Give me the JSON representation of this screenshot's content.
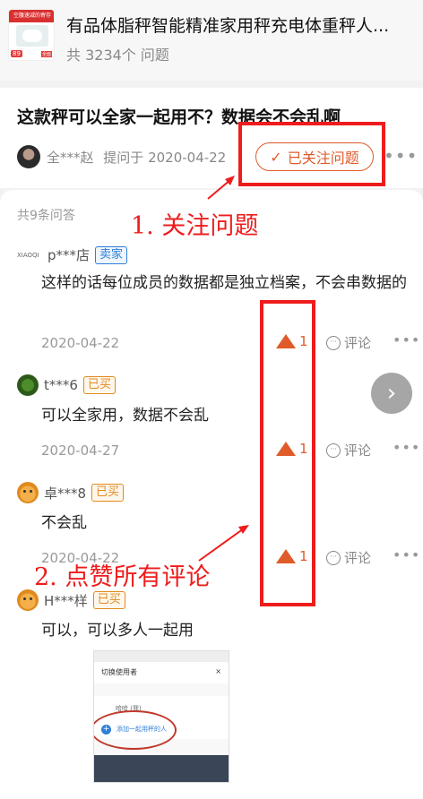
{
  "product": {
    "title": "有品体脂秤智能精准家用秤充电体重秤人...",
    "question_count": "共 3234个 问题",
    "thumb": {
      "banner": "空腹速减的寄存",
      "price": "89",
      "tag": "全面"
    }
  },
  "question": {
    "title": "这款秤可以全家一起用不？数据会不会乱啊",
    "asker_name": "全***赵",
    "asked_on": "提问于 2020-04-22",
    "follow_label": "已关注问题",
    "follow_icon": "✓"
  },
  "answers_header": "共9条问答",
  "answers": [
    {
      "user": "p***店",
      "avatar_text": "XIAOQI",
      "badge": "卖家",
      "text": "这样的话每位成员的数据都是独立档案，不会串数据的",
      "date": "2020-04-22",
      "likes": "1",
      "comment_label": "评论"
    },
    {
      "user": "t***6",
      "badge": "已买",
      "text": "可以全家用，数据不会乱",
      "date": "2020-04-27",
      "likes": "1",
      "comment_label": "评论"
    },
    {
      "user": "卓***8",
      "badge": "已买",
      "text": "不会乱",
      "date": "2020-04-22",
      "likes": "1",
      "comment_label": "评论"
    },
    {
      "user": "H***样",
      "badge": "已买",
      "text": "可以，可以多人一起用"
    }
  ],
  "image_screenshot": {
    "header": "切换使用者",
    "close": "×",
    "row_user": "哈哈 (我)",
    "row_add": "添加一起用秤的人"
  },
  "annotations": {
    "step1": "1. 关注问题",
    "step2": "2. 点赞所有评论",
    "color": "#ee1c1c"
  },
  "colors": {
    "accent": "#e05b2a",
    "seller": "#2f7fd8",
    "bought": "#e08a1e"
  },
  "icons": {
    "more": "•••",
    "next": "›",
    "comment": "···"
  }
}
